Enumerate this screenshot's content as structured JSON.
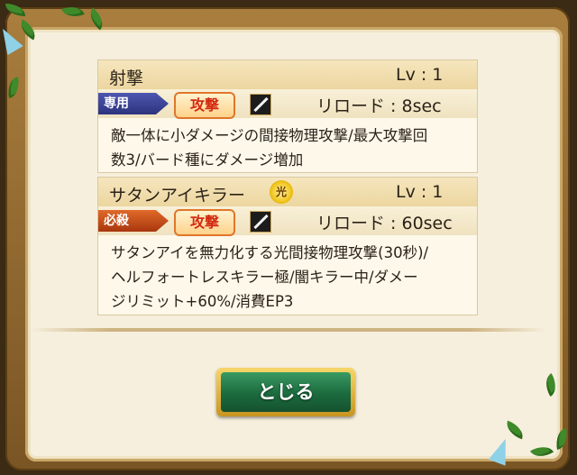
{
  "skills": [
    {
      "name": "射撃",
      "level": "Lv : 1",
      "type_tag": "専用",
      "category": "攻撃",
      "reload": "リロード : 8sec",
      "desc_lines": [
        "敵一体に小ダメージの間接物理攻撃/最大攻撃回",
        "数3/バード種にダメージ増加"
      ]
    },
    {
      "name": "サタンアイキラー",
      "element_badge": "光",
      "level": "Lv : 1",
      "type_tag": "必殺",
      "category": "攻撃",
      "reload": "リロード : 60sec",
      "desc_lines": [
        "サタンアイを無力化する光間接物理攻撃(30秒)/",
        "ヘルフォートレスキラー極/闇キラー中/ダメー",
        "ジリミット+60%/消費EP3"
      ]
    }
  ],
  "close_button": {
    "label": "とじる"
  },
  "colors": {
    "accent_blue": "#2d347e",
    "accent_red": "#a8370d",
    "button_green": "#1b6a3d"
  }
}
